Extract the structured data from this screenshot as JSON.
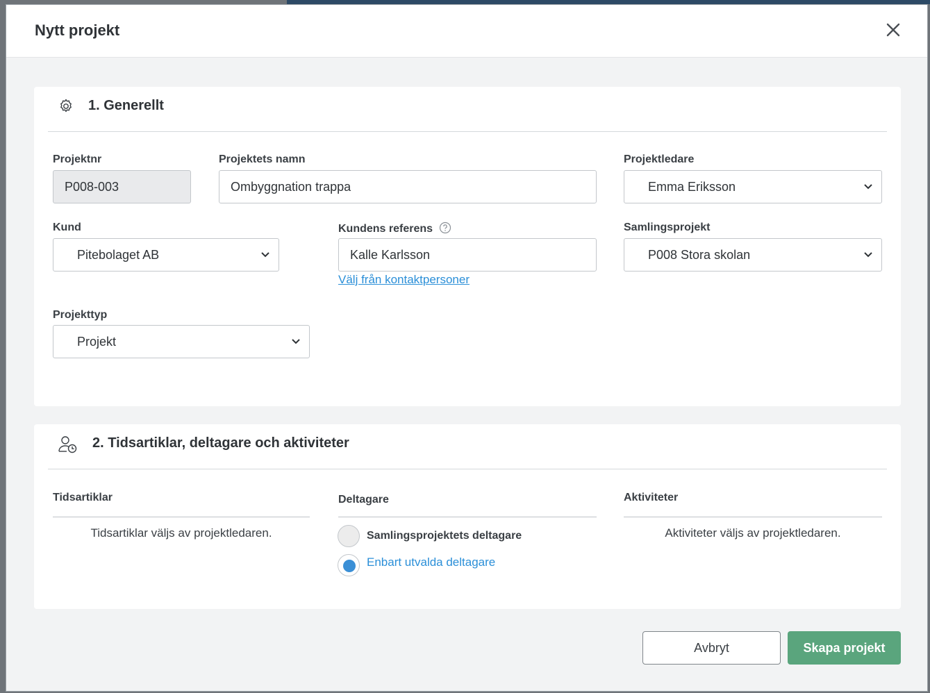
{
  "dialog": {
    "title": "Nytt projekt"
  },
  "general": {
    "heading": "1. Generellt",
    "project_number": {
      "label": "Projektnr",
      "value": "P008-003"
    },
    "project_name": {
      "label": "Projektets namn",
      "value": "Ombyggnation trappa"
    },
    "project_manager": {
      "label": "Projektledare",
      "value": "Emma Eriksson"
    },
    "customer": {
      "label": "Kund",
      "value": "Pitebolaget AB"
    },
    "customer_reference": {
      "label": "Kundens referens",
      "value": "Kalle Karlsson",
      "link": "Välj från kontaktpersoner"
    },
    "collection_project": {
      "label": "Samlingsprojekt",
      "value": "P008 Stora skolan"
    },
    "project_type": {
      "label": "Projekttyp",
      "value": "Projekt"
    }
  },
  "participants": {
    "heading": "2. Tidsartiklar, deltagare och aktiviteter",
    "time_articles": {
      "label": "Tidsartiklar",
      "text": "Tidsartiklar väljs av projektledaren."
    },
    "members": {
      "label": "Deltagare",
      "options": [
        {
          "label": "Samlingsprojektets deltagare",
          "checked": false
        },
        {
          "label": "Enbart utvalda deltagare",
          "checked": true
        }
      ]
    },
    "activities": {
      "label": "Aktiviteter",
      "text": "Aktiviteter väljs av projektledaren."
    }
  },
  "actions": {
    "cancel": "Avbryt",
    "create": "Skapa projekt"
  },
  "colors": {
    "accent": "#3a8fd6",
    "primary_button": "#5aa57d"
  }
}
